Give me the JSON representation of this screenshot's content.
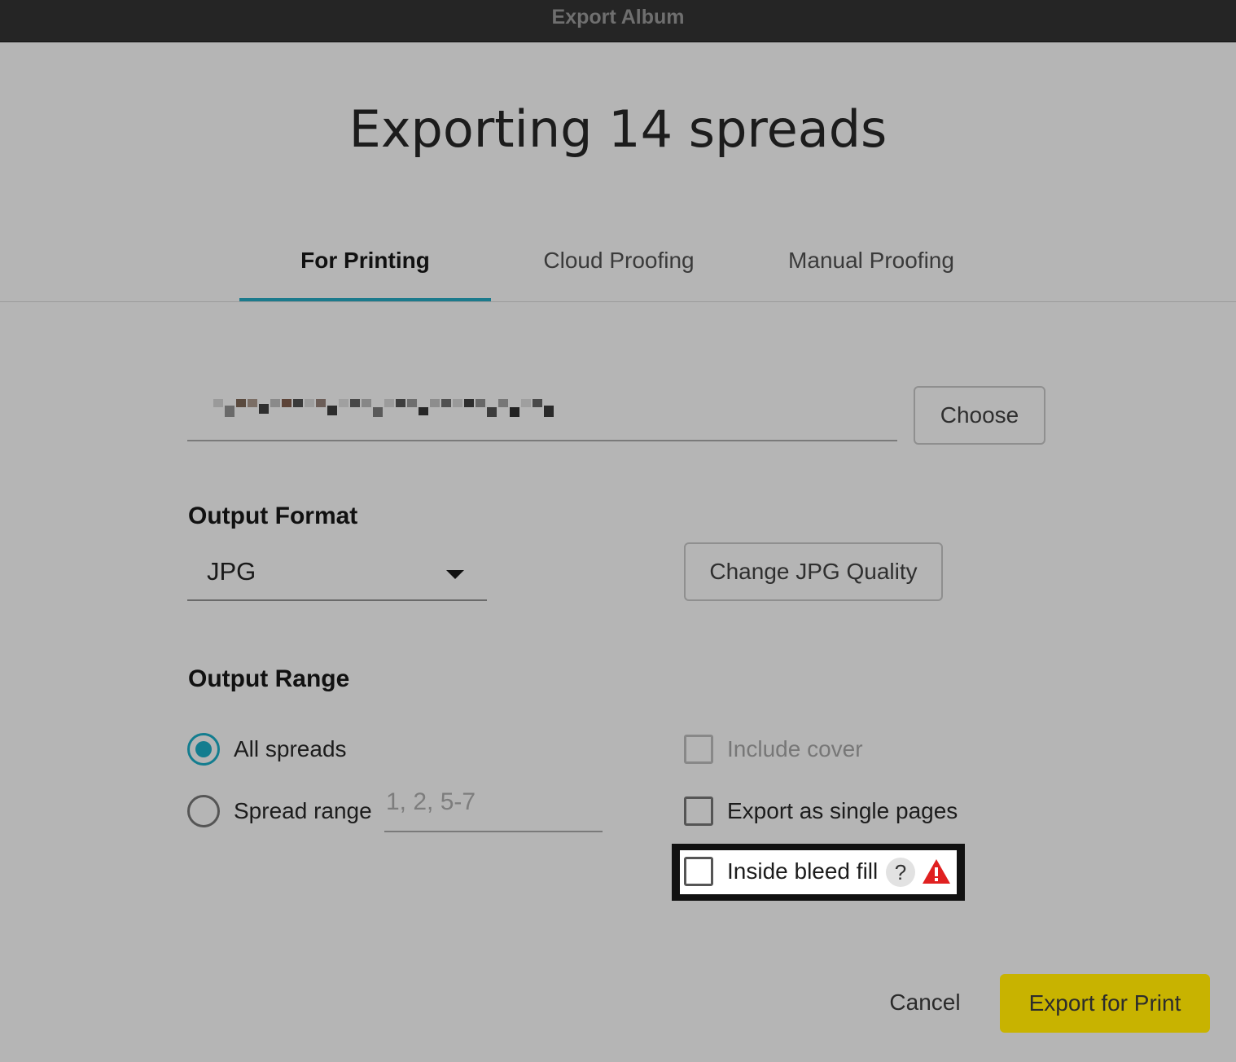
{
  "window": {
    "title": "Export Album"
  },
  "heading": "Exporting 14 spreads",
  "tabs": [
    {
      "label": "For Printing",
      "active": true
    },
    {
      "label": "Cloud Proofing",
      "active": false
    },
    {
      "label": "Manual Proofing",
      "active": false
    }
  ],
  "destination": {
    "choose_label": "Choose"
  },
  "output_format": {
    "label": "Output Format",
    "selected": "JPG",
    "quality_button": "Change JPG Quality"
  },
  "output_range": {
    "label": "Output Range",
    "all_spreads": {
      "label": "All spreads",
      "checked": true
    },
    "spread_range": {
      "label": "Spread range",
      "checked": false,
      "placeholder": "1, 2, 5-7"
    }
  },
  "options": {
    "include_cover": {
      "label": "Include cover",
      "checked": false,
      "disabled": true
    },
    "single_pages": {
      "label": "Export as single pages",
      "checked": false
    },
    "inside_bleed_fill": {
      "label": "Inside bleed fill",
      "checked": false,
      "help_glyph": "?"
    }
  },
  "footer": {
    "cancel": "Cancel",
    "export": "Export for Print"
  },
  "colors": {
    "accent": "#137d8f",
    "export_button": "#c8b300",
    "warning": "#e02020"
  }
}
